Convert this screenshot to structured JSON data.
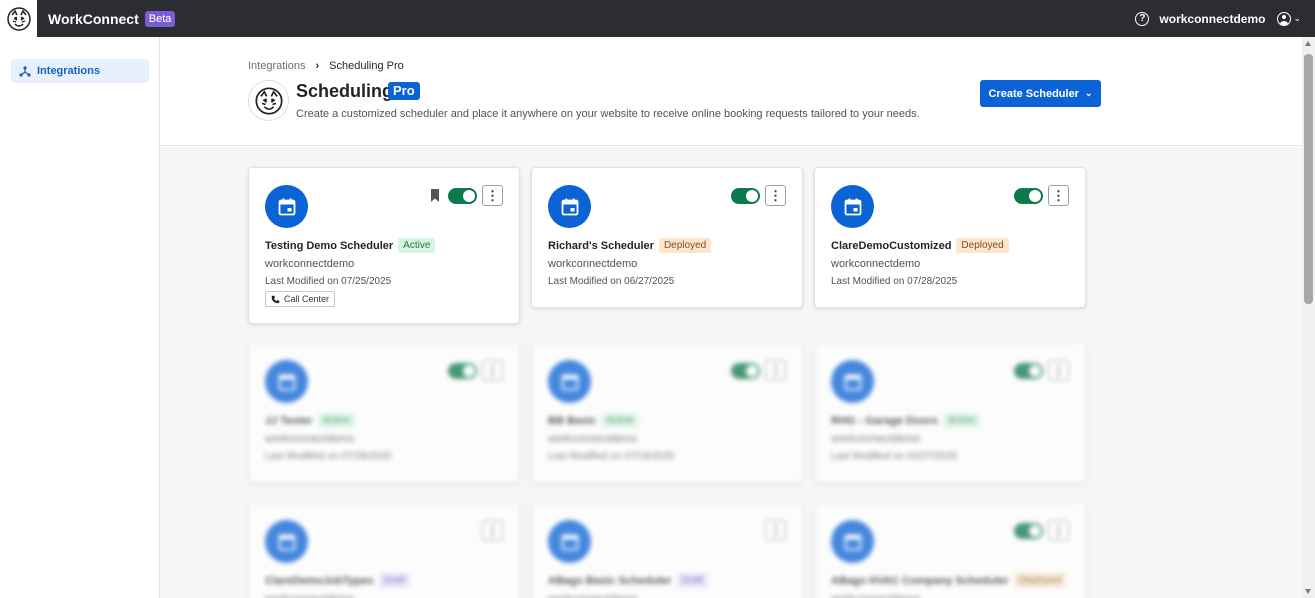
{
  "topbar": {
    "app_title": "WorkConnect",
    "beta_label": "Beta",
    "username": "workconnectdemo"
  },
  "sidebar": {
    "items": [
      {
        "label": "Integrations",
        "icon": "integrations-icon",
        "active": true
      }
    ]
  },
  "header": {
    "breadcrumb": [
      "Integrations",
      "Scheduling Pro"
    ],
    "breadcrumb_separator": "›",
    "title": "Scheduling",
    "title_badge": "Pro",
    "description": "Create a customized scheduler and place it anywhere on your website to receive online booking requests tailored to your needs.",
    "create_button": "Create Scheduler"
  },
  "colors": {
    "primary": "#0b63d6",
    "toggle_on": "#0c7a4a",
    "topbar": "#2b2d31",
    "beta": "#7b5cd6"
  },
  "cards": [
    {
      "name": "Testing Demo Scheduler",
      "status": "Active",
      "owner": "workconnectdemo",
      "modified": "Last Modified on 07/25/2025",
      "tag": "Call Center",
      "bookmarked": true,
      "enabled": true
    },
    {
      "name": "Richard's Scheduler",
      "status": "Deployed",
      "owner": "workconnectdemo",
      "modified": "Last Modified on 06/27/2025",
      "enabled": true
    },
    {
      "name": "ClareDemoCustomized",
      "status": "Deployed",
      "owner": "workconnectdemo",
      "modified": "Last Modified on 07/28/2025",
      "enabled": true
    },
    {
      "name": "JJ Tester",
      "status": "Active",
      "owner": "workconnectdemo",
      "modified": "Last Modified on 07/28/2025",
      "enabled": true
    },
    {
      "name": "BB Basic",
      "status": "Active",
      "owner": "workconnectdemo",
      "modified": "Last Modified on 07/18/2025",
      "enabled": true
    },
    {
      "name": "RHG - Garage Doors",
      "status": "Active",
      "owner": "workconnectdemo",
      "modified": "Last Modified on 02/27/2025",
      "enabled": true
    },
    {
      "name": "ClareDemoJobTypes",
      "status": "Draft",
      "owner": "workconnectdemo",
      "enabled": false
    },
    {
      "name": "ABags Basic Scheduler",
      "status": "Draft",
      "owner": "workconnectdemo",
      "enabled": false
    },
    {
      "name": "ABags HVAC Company Scheduler",
      "status": "Deployed",
      "owner": "workconnectdemo",
      "enabled": true
    }
  ]
}
